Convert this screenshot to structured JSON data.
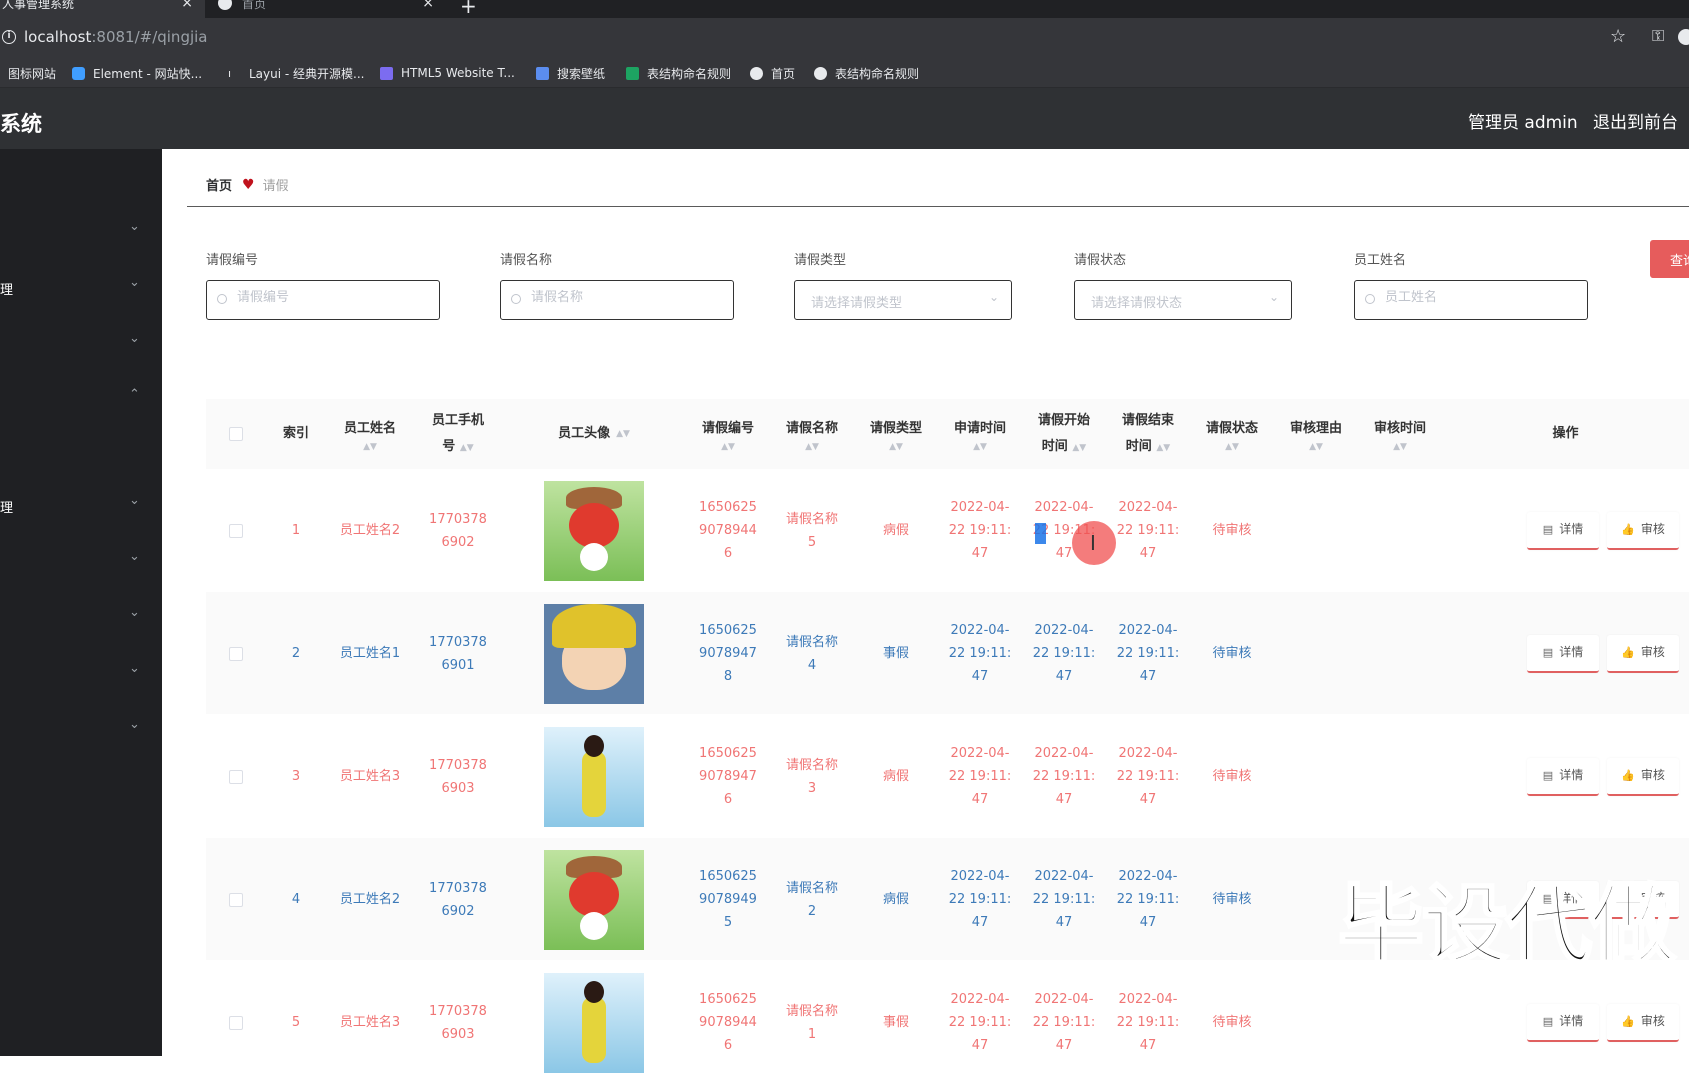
{
  "browser": {
    "tabs": [
      {
        "label": "人事管理系统",
        "close": "×"
      },
      {
        "label": "首页",
        "close": "×"
      }
    ],
    "new_tab": "+",
    "url_host": "localhost",
    "url_rest": ":8081/#/qingjia",
    "bookmarks": [
      {
        "label": "图标网站",
        "icon": "bookmark-icon"
      },
      {
        "label": "Element - 网站快...",
        "icon": "element-icon",
        "color": "#409eff"
      },
      {
        "label": "Layui - 经典开源模...",
        "icon": "layui-icon"
      },
      {
        "label": "HTML5 Website T...",
        "icon": "html5-icon",
        "color": "#7c6cf0"
      },
      {
        "label": "搜索壁纸",
        "icon": "wallpaper-icon",
        "color": "#5b8def"
      },
      {
        "label": "表结构命名规则",
        "icon": "table-icon",
        "color": "#1da462"
      },
      {
        "label": "首页",
        "icon": "globe-icon"
      },
      {
        "label": "表结构命名规则",
        "icon": "globe-icon"
      }
    ]
  },
  "header": {
    "title": "系统",
    "user": "管理员 admin",
    "exit": "退出到前台"
  },
  "sidebar": {
    "items": [
      {
        "label": "",
        "chevron": "⌄"
      },
      {
        "label": "理",
        "chevron": "⌄"
      },
      {
        "label": "",
        "chevron": "⌄"
      },
      {
        "label": "",
        "chevron": "⌃"
      },
      {
        "label": "理",
        "chevron": "⌄"
      },
      {
        "label": "",
        "chevron": "⌄"
      },
      {
        "label": "",
        "chevron": "⌄"
      },
      {
        "label": "",
        "chevron": "⌄"
      },
      {
        "label": "",
        "chevron": "⌄"
      }
    ]
  },
  "breadcrumb": {
    "home": "首页",
    "current": "请假"
  },
  "search": {
    "fields": [
      {
        "label": "请假编号",
        "placeholder": "请假编号"
      },
      {
        "label": "请假名称",
        "placeholder": "请假名称"
      },
      {
        "label": "请假类型",
        "placeholder": "请选择请假类型"
      },
      {
        "label": "请假状态",
        "placeholder": "请选择请假状态"
      },
      {
        "label": "员工姓名",
        "placeholder": "员工姓名"
      }
    ],
    "query_button": "查询"
  },
  "table": {
    "headers": {
      "index": "索引",
      "name": "员工姓名",
      "phone_1": "员工手机",
      "phone_2": "号",
      "avatar": "员工头像",
      "code": "请假编号",
      "lname": "请假名称",
      "type": "请假类型",
      "apply": "申请时间",
      "start_1": "请假开始",
      "start_2": "时间",
      "end_1": "请假结束",
      "end_2": "时间",
      "status": "请假状态",
      "reason": "审核理由",
      "rtime": "审核时间",
      "ops": "操作"
    },
    "detail_label": "详情",
    "audit_label": "审核",
    "rows": [
      {
        "index": "1",
        "name": "员工姓名2",
        "phone": [
          "1770378",
          "6902"
        ],
        "avatar": "fox",
        "code": [
          "1650625",
          "9078944",
          "6"
        ],
        "lname": [
          "请假名称",
          "5"
        ],
        "type": "病假",
        "apply": [
          "2022-04-",
          "22 19:11:",
          "47"
        ],
        "start": [
          "2022-04-",
          "22 19:11:",
          "47"
        ],
        "end": [
          "2022-04-",
          "22 19:11:",
          "47"
        ],
        "status": "待审核",
        "color": "red"
      },
      {
        "index": "2",
        "name": "员工姓名1",
        "phone": [
          "1770378",
          "6901"
        ],
        "avatar": "boy",
        "code": [
          "1650625",
          "9078947",
          "8"
        ],
        "lname": [
          "请假名称",
          "4"
        ],
        "type": "事假",
        "apply": [
          "2022-04-",
          "22 19:11:",
          "47"
        ],
        "start": [
          "2022-04-",
          "22 19:11:",
          "47"
        ],
        "end": [
          "2022-04-",
          "22 19:11:",
          "47"
        ],
        "status": "待审核",
        "color": "blue"
      },
      {
        "index": "3",
        "name": "员工姓名3",
        "phone": [
          "1770378",
          "6903"
        ],
        "avatar": "girl",
        "code": [
          "1650625",
          "9078947",
          "6"
        ],
        "lname": [
          "请假名称",
          "3"
        ],
        "type": "病假",
        "apply": [
          "2022-04-",
          "22 19:11:",
          "47"
        ],
        "start": [
          "2022-04-",
          "22 19:11:",
          "47"
        ],
        "end": [
          "2022-04-",
          "22 19:11:",
          "47"
        ],
        "status": "待审核",
        "color": "red"
      },
      {
        "index": "4",
        "name": "员工姓名2",
        "phone": [
          "1770378",
          "6902"
        ],
        "avatar": "fox",
        "code": [
          "1650625",
          "9078949",
          "5"
        ],
        "lname": [
          "请假名称",
          "2"
        ],
        "type": "病假",
        "apply": [
          "2022-04-",
          "22 19:11:",
          "47"
        ],
        "start": [
          "2022-04-",
          "22 19:11:",
          "47"
        ],
        "end": [
          "2022-04-",
          "22 19:11:",
          "47"
        ],
        "status": "待审核",
        "color": "blue"
      },
      {
        "index": "5",
        "name": "员工姓名3",
        "phone": [
          "1770378",
          "6903"
        ],
        "avatar": "girl",
        "code": [
          "1650625",
          "9078944",
          "6"
        ],
        "lname": [
          "请假名称",
          "1"
        ],
        "type": "事假",
        "apply": [
          "2022-04-",
          "22 19:11:",
          "47"
        ],
        "start": [
          "2022-04-",
          "22 19:11:",
          "47"
        ],
        "end": [
          "2022-04-",
          "22 19:11:",
          "47"
        ],
        "status": "待审核",
        "color": "red"
      }
    ]
  },
  "watermark": "毕设代做"
}
